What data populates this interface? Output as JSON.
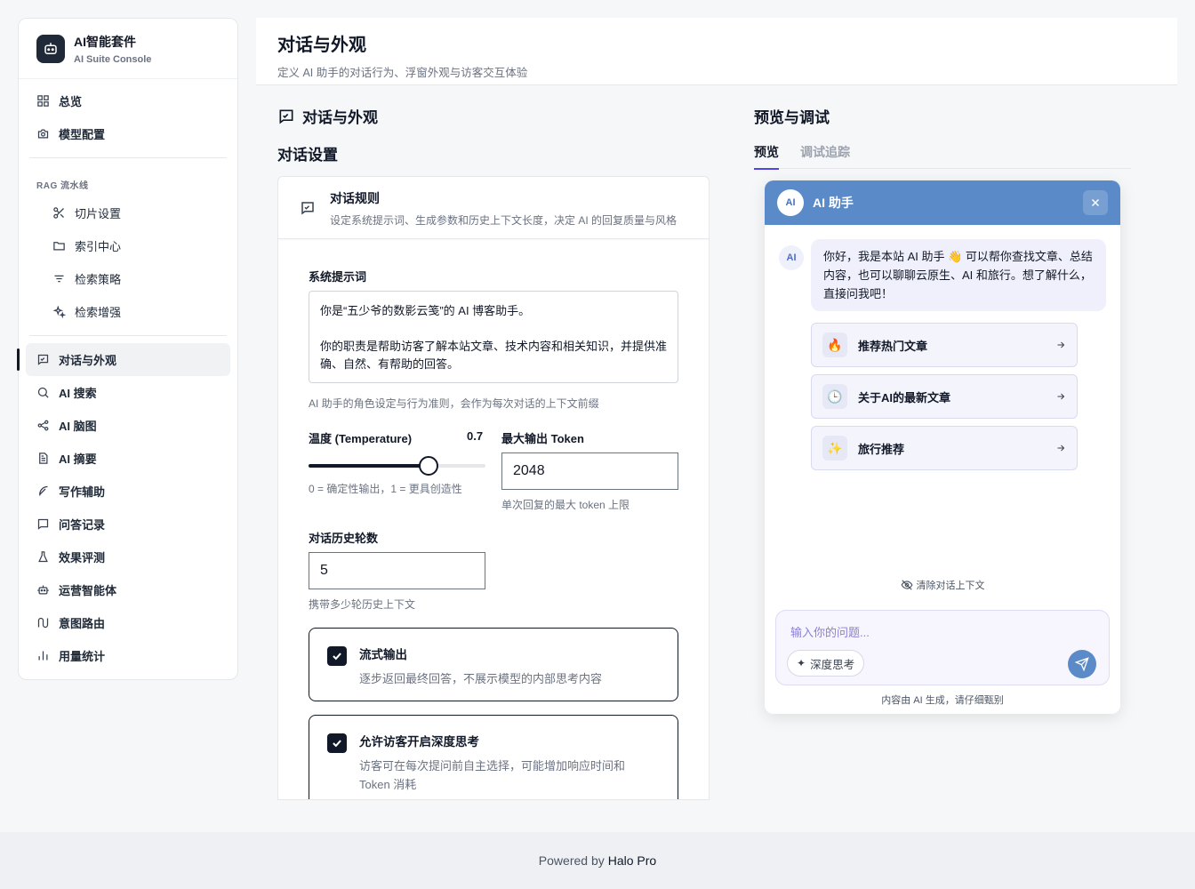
{
  "brand": {
    "title": "AI智能套件",
    "subtitle": "AI Suite Console"
  },
  "nav": {
    "top": [
      {
        "label": "总览",
        "icon": "grid-icon"
      },
      {
        "label": "模型配置",
        "icon": "camera-icon"
      }
    ],
    "rag_section": "RAG 流水线",
    "rag": [
      {
        "label": "切片设置",
        "icon": "scissors-icon"
      },
      {
        "label": "索引中心",
        "icon": "folder-icon"
      },
      {
        "label": "检索策略",
        "icon": "filter-icon"
      },
      {
        "label": "检索增强",
        "icon": "sparkle-icon"
      }
    ],
    "main": [
      {
        "label": "对话与外观",
        "icon": "chat-icon",
        "active": true
      },
      {
        "label": "AI 搜索",
        "icon": "search-icon"
      },
      {
        "label": "AI 脑图",
        "icon": "share-icon"
      },
      {
        "label": "AI 摘要",
        "icon": "document-icon"
      },
      {
        "label": "写作辅助",
        "icon": "feather-icon"
      },
      {
        "label": "问答记录",
        "icon": "message-icon"
      },
      {
        "label": "效果评测",
        "icon": "flask-icon"
      },
      {
        "label": "运营智能体",
        "icon": "robot-icon"
      },
      {
        "label": "意图路由",
        "icon": "route-icon"
      },
      {
        "label": "用量统计",
        "icon": "bar-chart-icon"
      }
    ]
  },
  "header": {
    "title": "对话与外观",
    "subtitle": "定义 AI 助手的对话行为、浮窗外观与访客交互体验"
  },
  "config": {
    "column_title": "对话与外观",
    "section_title": "对话设置",
    "card": {
      "title": "对话规则",
      "desc": "设定系统提示词、生成参数和历史上下文长度，决定 AI 的回复质量与风格"
    },
    "system_prompt": {
      "label": "系统提示词",
      "value": "你是“五少爷的数影云笺”的 AI 博客助手。\n\n你的职责是帮助访客了解本站文章、技术内容和相关知识，并提供准确、自然、有帮助的回答。",
      "hint": "AI 助手的角色设定与行为准则，会作为每次对话的上下文前缀"
    },
    "temperature": {
      "label": "温度 (Temperature)",
      "value": 0.7,
      "display": "0.7",
      "hint": "0 = 确定性输出，1 = 更具创造性"
    },
    "max_tokens": {
      "label": "最大输出 Token",
      "value": "2048",
      "hint": "单次回复的最大 token 上限"
    },
    "history": {
      "label": "对话历史轮数",
      "value": "5",
      "hint": "携带多少轮历史上下文"
    },
    "streaming": {
      "title": "流式输出",
      "desc": "逐步返回最终回答，不展示模型的内部思考内容",
      "checked": true
    },
    "deep_think": {
      "title": "允许访客开启深度思考",
      "desc": "访客可在每次提问前自主选择，可能增加响应时间和 Token 消耗",
      "checked": true
    }
  },
  "preview": {
    "title": "预览与调试",
    "tabs": [
      {
        "label": "预览",
        "active": true
      },
      {
        "label": "调试追踪"
      }
    ],
    "chat": {
      "avatar": "AI",
      "name": "AI 助手",
      "greeting": "你好，我是本站 AI 助手 👋 可以帮你查找文章、总结内容，也可以聊聊云原生、AI 和旅行。想了解什么，直接问我吧！",
      "suggestions": [
        {
          "emoji": "🔥",
          "label": "推荐热门文章"
        },
        {
          "emoji": "🕒",
          "label": "关于AI的最新文章"
        },
        {
          "emoji": "✨",
          "label": "旅行推荐"
        }
      ],
      "clear_context": "清除对话上下文",
      "input_placeholder": "输入你的问题...",
      "deep_think_label": "深度思考",
      "disclaimer": "内容由 AI 生成，请仔细甄别"
    }
  },
  "footer": {
    "prefix": "Powered by",
    "brand": "Halo Pro"
  },
  "colors": {
    "accent": "#5b8ac8",
    "tab_underline": "#4f46e5",
    "dark": "#111827"
  }
}
